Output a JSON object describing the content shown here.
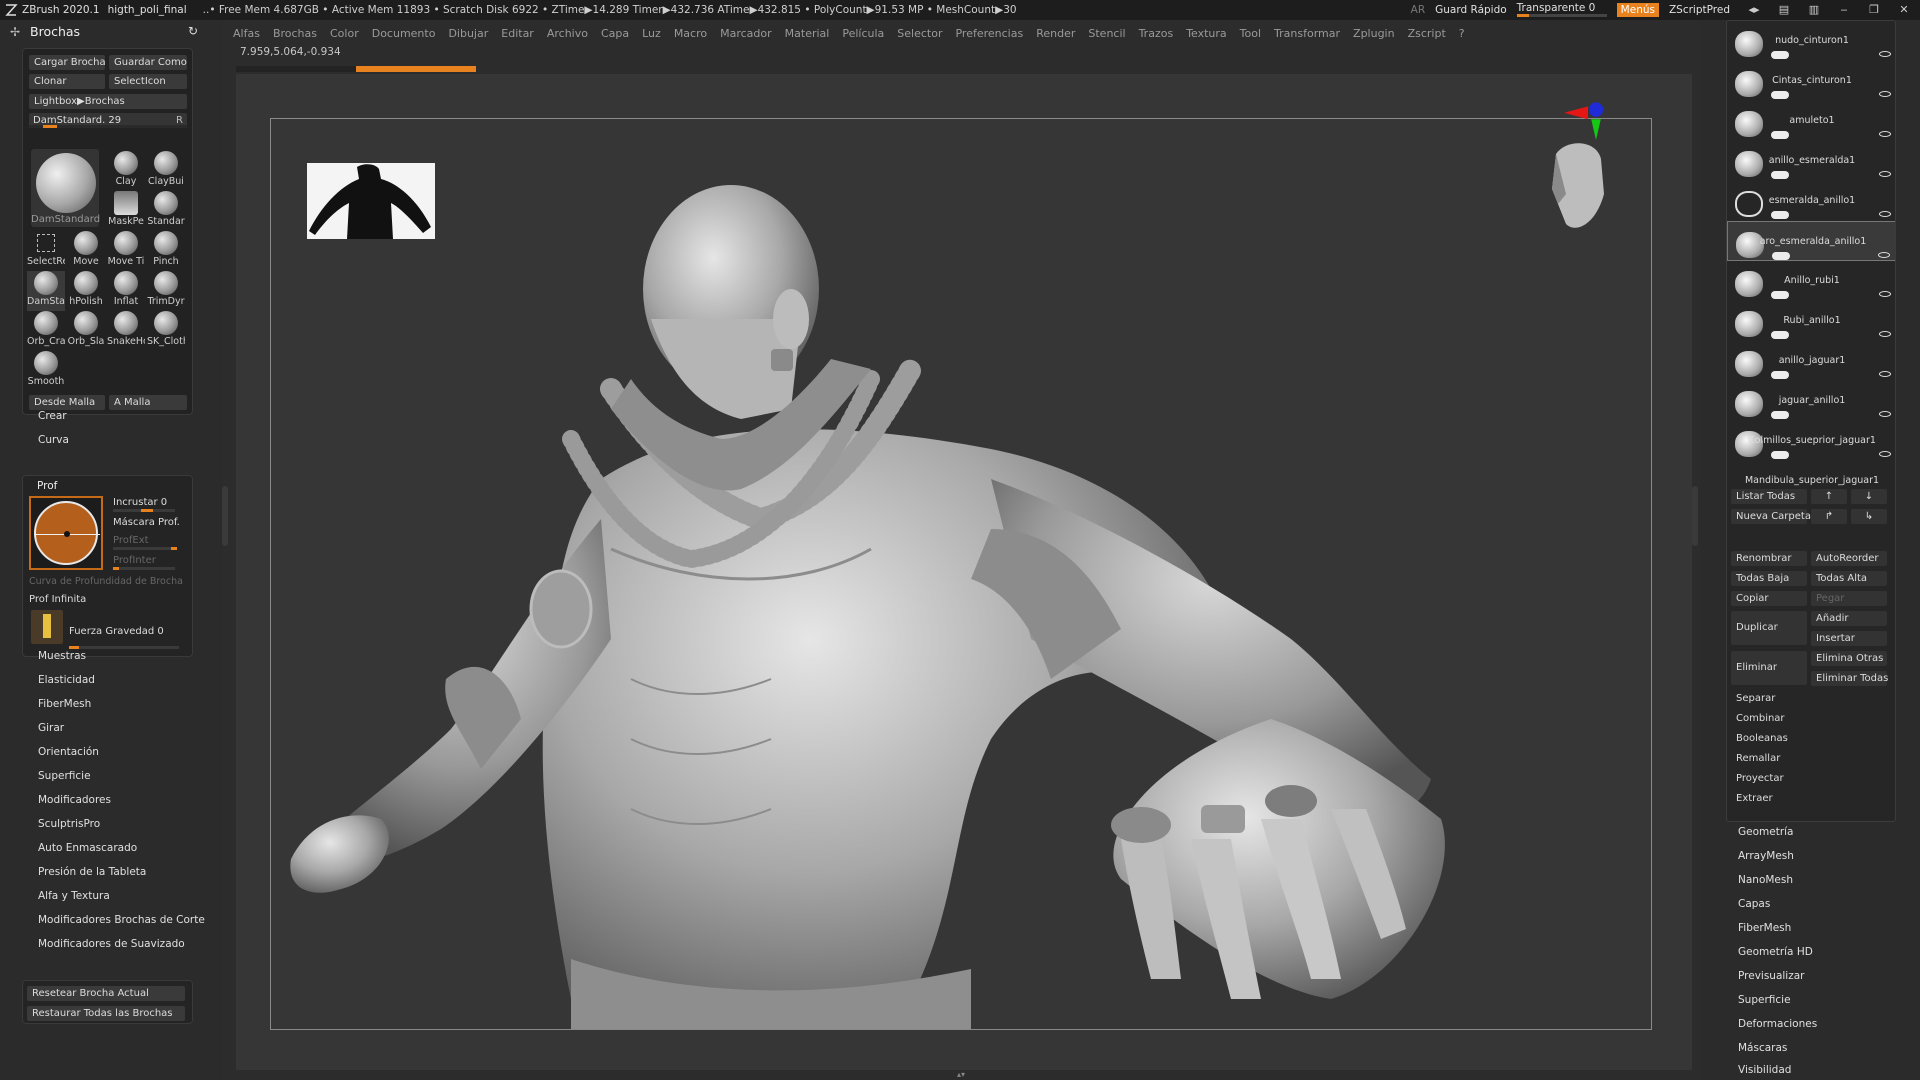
{
  "topbar": {
    "app": "ZBrush 2020.1",
    "file": "higth_poli_final",
    "stats": "..• Free Mem 4.687GB • Active Mem 11893 • Scratch Disk 6922 •  ZTime▶14.289 Timer▶432.736 ATime▶432.815 • PolyCount▶91.53 MP  • MeshCount▶30",
    "ar": "AR",
    "quicksave": "Guard Rápido",
    "transparent": "Transparente 0",
    "menus": "Menús",
    "script": "ZScriptPred"
  },
  "menubar": [
    "Alfas",
    "Brochas",
    "Color",
    "Documento",
    "Dibujar",
    "Editar",
    "Archivo",
    "Capa",
    "Luz",
    "Macro",
    "Marcador",
    "Material",
    "Película",
    "Selector",
    "Preferencias",
    "Render",
    "Stencil",
    "Trazos",
    "Textura",
    "Tool",
    "Transformar",
    "Zplugin",
    "Zscript",
    "?"
  ],
  "coords": "7.959,5.064,-0.934",
  "left": {
    "title": "Brochas",
    "buttons": [
      "Cargar Brocha",
      "Guardar Como",
      "Clonar",
      "SelectIcon",
      "Lightbox▶Brochas"
    ],
    "brush_slider": "DamStandard. 29",
    "brush_slider_r": "R",
    "current_brush": "DamStandard",
    "brushes": [
      "Clay",
      "ClayBui",
      "MaskPe",
      "Standar",
      "SelectRe",
      "Move",
      "Move Ti",
      "Pinch",
      "DamSta",
      "hPolish",
      "Inflat",
      "TrimDyr",
      "Orb_Cra",
      "Orb_Sla",
      "SnakeHo",
      "SK_Cloth",
      "Smooth"
    ],
    "from_mesh": "Desde Malla",
    "to_mesh": "A Malla",
    "crear": "Crear",
    "curva": "Curva",
    "prof": {
      "title": "Prof",
      "incrustar": "Incrustar 0",
      "mascara": "Máscara Prof.",
      "profext": "ProfExt",
      "profinter": "ProfInter",
      "curva": "Curva de Profundidad de Brocha",
      "infinita": "Prof Infinita",
      "gravedad": "Fuerza Gravedad 0"
    },
    "menu": [
      "Muestras",
      "Elasticidad",
      "FiberMesh",
      "Girar",
      "Orientación",
      "Superficie",
      "Modificadores",
      "SculptrisPro",
      "Auto Enmascarado",
      "Presión de la Tableta",
      "Alfa y Textura",
      "Modificadores Brochas de Corte",
      "Modificadores de Suavizado"
    ],
    "reset": "Resetear Brocha Actual",
    "restore": "Restaurar Todas las Brochas"
  },
  "subtools": [
    {
      "name": "nudo_cinturon1"
    },
    {
      "name": "Cintas_cinturon1"
    },
    {
      "name": "amuleto1"
    },
    {
      "name": "anillo_esmeralda1"
    },
    {
      "name": "esmeralda_anillo1"
    },
    {
      "name": "aro_esmeralda_anillo1"
    },
    {
      "name": "Anillo_rubi1"
    },
    {
      "name": "Rubi_anillo1"
    },
    {
      "name": "anillo_jaguar1"
    },
    {
      "name": "jaguar_anillo1"
    },
    {
      "name": "Colmillos_sueprior_jaguar1"
    },
    {
      "name": "Mandibula_superior_jaguar1"
    }
  ],
  "right": {
    "listar": "Listar Todas",
    "nueva": "Nueva Carpeta",
    "renombrar": "Renombrar",
    "autoreorder": "AutoReorder",
    "todasbaja": "Todas Baja",
    "todasalta": "Todas Alta",
    "copiar": "Copiar",
    "pegar": "Pegar",
    "duplicar": "Duplicar",
    "anadir": "Añadir",
    "insertar": "Insertar",
    "eliminar": "Eliminar",
    "eliminaotras": "Elimina Otras",
    "eliminartodas": "Eliminar Todas",
    "separar": "Separar",
    "combinar": "Combinar",
    "booleanas": "Booleanas",
    "remallar": "Remallar",
    "proyectar": "Proyectar",
    "extraer": "Extraer",
    "menu": [
      "Geometría",
      "ArrayMesh",
      "NanoMesh",
      "Capas",
      "FiberMesh",
      "Geometría HD",
      "Previsualizar",
      "Superficie",
      "Deformaciones",
      "Máscaras",
      "Visibilidad"
    ]
  },
  "colors": {
    "accent": "#e8821e",
    "panel": "#2b2b2b",
    "viewport": "#363636"
  }
}
